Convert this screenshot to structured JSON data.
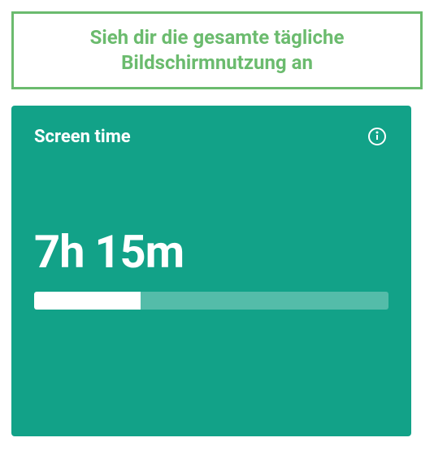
{
  "banner": {
    "text": "Sieh dir die gesamte tägliche Bildschirmnutzung an"
  },
  "card": {
    "title": "Screen time",
    "time_value": "7h 15m",
    "progress_percent": 30
  },
  "colors": {
    "banner_border": "#6bbb6e",
    "card_bg": "#12a288"
  }
}
